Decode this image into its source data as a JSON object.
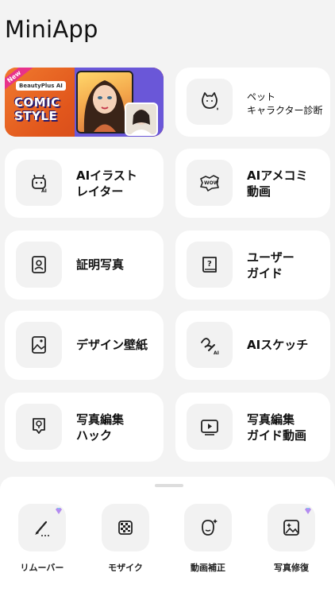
{
  "app": {
    "title": "MiniApp"
  },
  "banner": {
    "ribbon": "New",
    "brand": "BeautyPlus AI",
    "line1": "COMIC",
    "line2": "STYLE"
  },
  "cards": [
    {
      "id": "pet",
      "icon": "cat-face-icon",
      "line1": "ペット",
      "line2": "キャラクター診断"
    },
    {
      "id": "ai-illustrator",
      "icon": "ai-robot-icon",
      "line1": "AIイラスト",
      "line2": "レイター"
    },
    {
      "id": "ai-comic",
      "icon": "wow-bubble-icon",
      "line1": "AIアメコミ",
      "line2": "動画"
    },
    {
      "id": "id-photo",
      "icon": "id-portrait-icon",
      "line1": "証明写真",
      "line2": ""
    },
    {
      "id": "user-guide",
      "icon": "question-book-icon",
      "line1": "ユーザー",
      "line2": "ガイド"
    },
    {
      "id": "wallpaper",
      "icon": "wallpaper-image-icon",
      "line1": "デザイン壁紙",
      "line2": ""
    },
    {
      "id": "ai-sketch",
      "icon": "ai-pen-icon",
      "line1": "AIスケッチ",
      "line2": ""
    },
    {
      "id": "edit-hack",
      "icon": "lightbulb-icon",
      "line1": "写真編集",
      "line2": "ハック"
    },
    {
      "id": "edit-guide-video",
      "icon": "play-video-icon",
      "line1": "写真編集",
      "line2": "ガイド動画"
    }
  ],
  "tools": [
    {
      "id": "remover",
      "icon": "eraser-brush-icon",
      "label": "リムーバー",
      "premium": true
    },
    {
      "id": "mosaic",
      "icon": "mosaic-grid-icon",
      "label": "モザイク",
      "premium": false
    },
    {
      "id": "video-retouch",
      "icon": "face-sparkle-icon",
      "label": "動画補正",
      "premium": false
    },
    {
      "id": "photo-repair",
      "icon": "image-sparkle-icon",
      "label": "写真修復",
      "premium": true
    }
  ]
}
